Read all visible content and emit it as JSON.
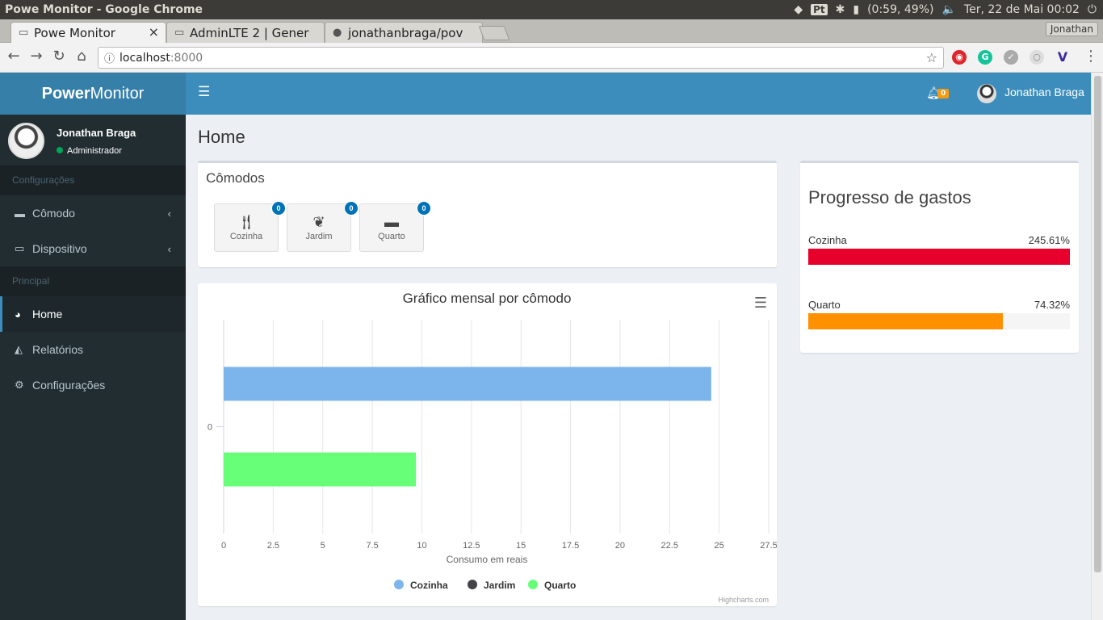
{
  "os": {
    "window_title": "Powe Monitor - Google Chrome",
    "battery": "(0:59, 49%)",
    "datetime": "Ter, 22 de Mai 00:02",
    "kbd": "Pt"
  },
  "browser": {
    "tabs": [
      {
        "label": "Powe Monitor"
      },
      {
        "label": "AdminLTE 2 | Gener"
      },
      {
        "label": "jonathanbraga/pov"
      }
    ],
    "profile": "Jonathan",
    "url_host": "localhost",
    "url_port": ":8000"
  },
  "app": {
    "logo_bold": "Power",
    "logo_rest": "Monitor",
    "user": {
      "name": "Jonathan Braga",
      "role": "Administrador"
    },
    "sidebar": {
      "header1": "Configurações",
      "items1": [
        {
          "label": "Cômodo"
        },
        {
          "label": "Dispositivo"
        }
      ],
      "header2": "Principal",
      "items2": [
        {
          "label": "Home"
        },
        {
          "label": "Relatórios"
        },
        {
          "label": "Configurações"
        }
      ]
    },
    "topnav": {
      "notif_count": "0",
      "user": "Jonathan Braga"
    },
    "page_title": "Home",
    "comodos": {
      "title": "Cômodos",
      "rooms": [
        {
          "label": "Cozinha",
          "count": "0"
        },
        {
          "label": "Jardim",
          "count": "0"
        },
        {
          "label": "Quarto",
          "count": "0"
        }
      ]
    },
    "progress": {
      "title": "Progresso de gastos",
      "items": [
        {
          "label": "Cozinha",
          "value_text": "245.61%",
          "fraction": 1.0,
          "color": "#e8002d"
        },
        {
          "label": "Quarto",
          "value_text": "74.32%",
          "fraction": 0.7432,
          "color": "#ff9000"
        }
      ]
    },
    "credits": "Highcharts.com"
  },
  "chart_data": {
    "type": "bar",
    "title": "Gráfico mensal por cômodo",
    "xlabel": "Consumo em reais",
    "categories": [
      "0"
    ],
    "xlim": [
      0,
      27.5
    ],
    "ticks": [
      "0",
      "2.5",
      "5",
      "7.5",
      "10",
      "12.5",
      "15",
      "17.5",
      "20",
      "22.5",
      "25",
      "27.5"
    ],
    "series": [
      {
        "name": "Cozinha",
        "color": "#7cb5ec",
        "values": [
          24.6
        ]
      },
      {
        "name": "Jardim",
        "color": "#434348",
        "values": [
          0
        ]
      },
      {
        "name": "Quarto",
        "color": "#66ff77",
        "values": [
          9.7
        ]
      }
    ],
    "legend": "bottom-center"
  }
}
